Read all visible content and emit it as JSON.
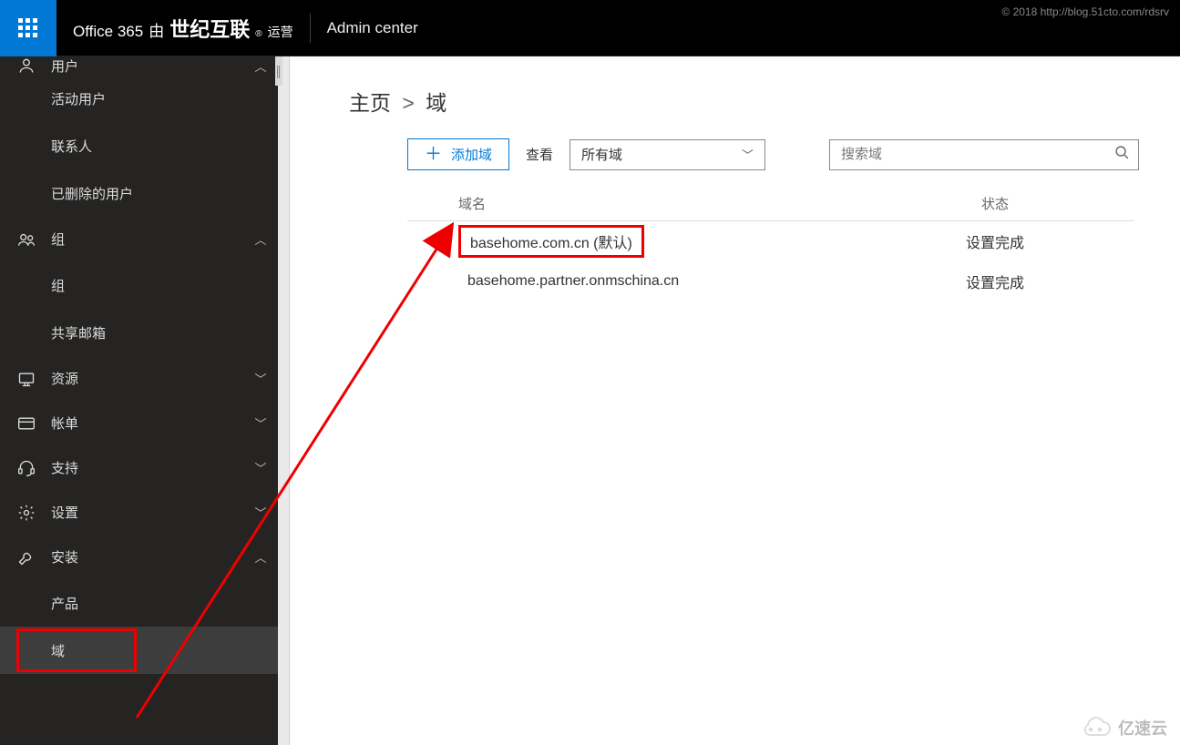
{
  "topbar": {
    "product": "Office 365",
    "by": "由",
    "operator": "世纪互联",
    "suffix": "运营",
    "admin_center": "Admin center",
    "copyright": "© 2018 http://blog.51cto.com/rdsrv"
  },
  "sidebar": {
    "users": {
      "label": "用户",
      "items": [
        "活动用户",
        "联系人",
        "已删除的用户"
      ]
    },
    "groups": {
      "label": "组",
      "items": [
        "组",
        "共享邮箱"
      ]
    },
    "resources": {
      "label": "资源"
    },
    "billing": {
      "label": "帐单"
    },
    "support": {
      "label": "支持"
    },
    "settings": {
      "label": "设置"
    },
    "setup": {
      "label": "安装",
      "items": [
        "产品",
        "域"
      ]
    }
  },
  "breadcrumb": {
    "home": "主页",
    "current": "域"
  },
  "toolbar": {
    "add_domain": "添加域",
    "view_label": "查看",
    "dropdown_value": "所有域",
    "search_placeholder": "搜索域"
  },
  "table": {
    "col_name": "域名",
    "col_status": "状态",
    "rows": [
      {
        "name": "basehome.com.cn (默认)",
        "status": "设置完成"
      },
      {
        "name": "basehome.partner.onmschina.cn",
        "status": "设置完成"
      }
    ]
  },
  "watermark": "亿速云"
}
